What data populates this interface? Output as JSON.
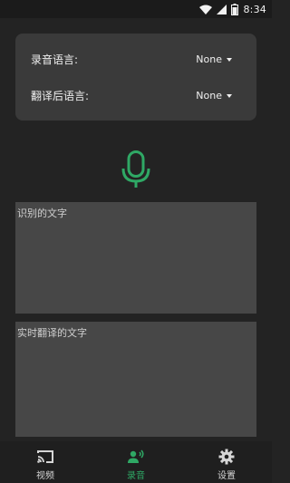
{
  "status_bar": {
    "time": "8:34",
    "battery_level": 0.75
  },
  "language_card": {
    "recording_language_label": "录音语言:",
    "recording_language_value": "None",
    "translated_language_label": "翻译后语言:",
    "translated_language_value": "None"
  },
  "text_areas": {
    "recognized_placeholder": "识别的文字",
    "translated_placeholder": "实时翻译的文字"
  },
  "bottom_nav": {
    "items": [
      {
        "label": "视频",
        "icon": "cast-icon",
        "active": false
      },
      {
        "label": "录音",
        "icon": "record-voice-icon",
        "active": true
      },
      {
        "label": "设置",
        "icon": "gear-icon",
        "active": false
      }
    ]
  },
  "colors": {
    "accent": "#2fa865",
    "background": "#232323",
    "card": "#3a3a3a",
    "text_box": "#474747"
  }
}
